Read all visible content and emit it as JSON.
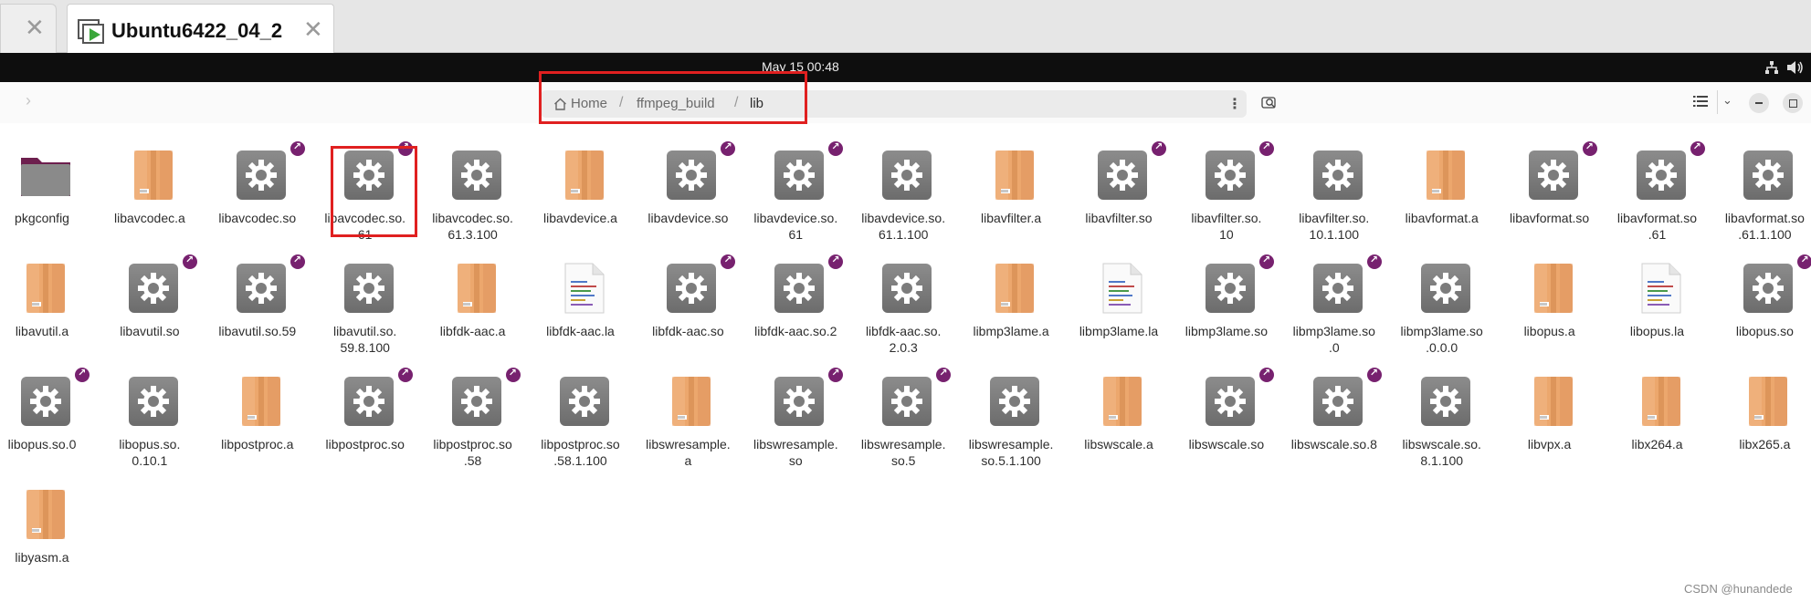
{
  "host": {
    "tabs": [
      {
        "label": "",
        "close": "✕"
      },
      {
        "label": "Ubuntu6422_04_2",
        "close": "✕"
      }
    ]
  },
  "panel": {
    "clock": "May 15  00:48"
  },
  "header": {
    "breadcrumb": [
      "Home",
      "ffmpeg_build",
      "lib"
    ],
    "separator": "/",
    "menu_glyph": "⋮",
    "forward_glyph": "›",
    "view_chevron": "⌄"
  },
  "files": [
    {
      "name": "pkgconfig",
      "type": "folder",
      "link": false
    },
    {
      "name": "libavcodec.a",
      "type": "archive",
      "link": false
    },
    {
      "name": "libavcodec.so",
      "type": "lib",
      "link": true
    },
    {
      "name": "libavcodec.so.\n61",
      "type": "lib",
      "link": true
    },
    {
      "name": "libavcodec.so.\n61.3.100",
      "type": "lib",
      "link": false
    },
    {
      "name": "libavdevice.a",
      "type": "archive",
      "link": false
    },
    {
      "name": "libavdevice.so",
      "type": "lib",
      "link": true
    },
    {
      "name": "libavdevice.so.\n61",
      "type": "lib",
      "link": true
    },
    {
      "name": "libavdevice.so.\n61.1.100",
      "type": "lib",
      "link": false
    },
    {
      "name": "libavfilter.a",
      "type": "archive",
      "link": false
    },
    {
      "name": "libavfilter.so",
      "type": "lib",
      "link": true
    },
    {
      "name": "libavfilter.so.\n10",
      "type": "lib",
      "link": true
    },
    {
      "name": "libavfilter.so.\n10.1.100",
      "type": "lib",
      "link": false
    },
    {
      "name": "libavformat.a",
      "type": "archive",
      "link": false
    },
    {
      "name": "libavformat.so",
      "type": "lib",
      "link": true
    },
    {
      "name": "libavformat.so\n.61",
      "type": "lib",
      "link": true
    },
    {
      "name": "libavformat.so\n.61.1.100",
      "type": "lib",
      "link": false
    },
    {
      "name": "libavutil.a",
      "type": "archive",
      "link": false
    },
    {
      "name": "libavutil.so",
      "type": "lib",
      "link": true
    },
    {
      "name": "libavutil.so.59",
      "type": "lib",
      "link": true
    },
    {
      "name": "libavutil.so.\n59.8.100",
      "type": "lib",
      "link": false
    },
    {
      "name": "libfdk-aac.a",
      "type": "archive",
      "link": false
    },
    {
      "name": "libfdk-aac.la",
      "type": "text",
      "link": false
    },
    {
      "name": "libfdk-aac.so",
      "type": "lib",
      "link": true
    },
    {
      "name": "libfdk-aac.so.2",
      "type": "lib",
      "link": true
    },
    {
      "name": "libfdk-aac.so.\n2.0.3",
      "type": "lib",
      "link": false
    },
    {
      "name": "libmp3lame.a",
      "type": "archive",
      "link": false
    },
    {
      "name": "libmp3lame.la",
      "type": "text",
      "link": false
    },
    {
      "name": "libmp3lame.so",
      "type": "lib",
      "link": true
    },
    {
      "name": "libmp3lame.so\n.0",
      "type": "lib",
      "link": true
    },
    {
      "name": "libmp3lame.so\n.0.0.0",
      "type": "lib",
      "link": false
    },
    {
      "name": "libopus.a",
      "type": "archive",
      "link": false
    },
    {
      "name": "libopus.la",
      "type": "text",
      "link": false
    },
    {
      "name": "libopus.so",
      "type": "lib",
      "link": true
    },
    {
      "name": "libopus.so.0",
      "type": "lib",
      "link": true
    },
    {
      "name": "libopus.so.\n0.10.1",
      "type": "lib",
      "link": false
    },
    {
      "name": "libpostproc.a",
      "type": "archive",
      "link": false
    },
    {
      "name": "libpostproc.so",
      "type": "lib",
      "link": true
    },
    {
      "name": "libpostproc.so\n.58",
      "type": "lib",
      "link": true
    },
    {
      "name": "libpostproc.so\n.58.1.100",
      "type": "lib",
      "link": false
    },
    {
      "name": "libswresample.\na",
      "type": "archive",
      "link": false
    },
    {
      "name": "libswresample.\nso",
      "type": "lib",
      "link": true
    },
    {
      "name": "libswresample.\nso.5",
      "type": "lib",
      "link": true
    },
    {
      "name": "libswresample.\nso.5.1.100",
      "type": "lib",
      "link": false
    },
    {
      "name": "libswscale.a",
      "type": "archive",
      "link": false
    },
    {
      "name": "libswscale.so",
      "type": "lib",
      "link": true
    },
    {
      "name": "libswscale.so.8",
      "type": "lib",
      "link": true
    },
    {
      "name": "libswscale.so.\n8.1.100",
      "type": "lib",
      "link": false
    },
    {
      "name": "libvpx.a",
      "type": "archive",
      "link": false
    },
    {
      "name": "libx264.a",
      "type": "archive",
      "link": false
    },
    {
      "name": "libx265.a",
      "type": "archive",
      "link": false
    },
    {
      "name": "libyasm.a",
      "type": "archive",
      "link": false
    }
  ],
  "watermark": "CSDN @hunandede",
  "colors": {
    "link_badge": "#77216f",
    "annotation": "#e02020",
    "archive": "#e9a56f",
    "gear_bg": "#7d7d7d"
  }
}
